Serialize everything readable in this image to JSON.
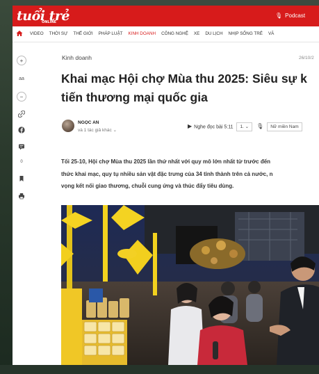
{
  "site": {
    "logo": "tuổi trẻ",
    "logo_sub": "ONLINE",
    "podcast_label": "Podcast"
  },
  "nav": {
    "items": [
      {
        "label": "VIDEO"
      },
      {
        "label": "THỜI SỰ"
      },
      {
        "label": "THẾ GIỚI"
      },
      {
        "label": "PHÁP LUẬT"
      },
      {
        "label": "KINH DOANH",
        "active": true
      },
      {
        "label": "CÔNG NGHỆ"
      },
      {
        "label": "XE"
      },
      {
        "label": "DU LỊCH"
      },
      {
        "label": "NHỊP SỐNG TRẺ"
      },
      {
        "label": "VĂ"
      }
    ]
  },
  "toolbar": {
    "font_size_label": "aa",
    "comment_count": "0"
  },
  "article": {
    "category": "Kinh doanh",
    "date": "26/10/2",
    "title_line1": "Khai mạc Hội chợ Mùa thu 2025: Siêu sự k",
    "title_line2": "tiến thương mại quốc gia",
    "author_name": "NGỌC AN",
    "author_more": "và 1 tác giả khác",
    "listen_label": "Nghe đọc bài",
    "duration": "5:11",
    "speed": "1.",
    "voice": "Nữ miền Nam",
    "intro_lines": [
      "Tối 25-10, Hội chợ Mùa thu 2025 lần thứ nhất với quy mô lớn nhất từ trước đến",
      "thức khai mạc, quy tụ nhiều sản vật đặc trưng của 34 tỉnh thành trên cả nước, n",
      "vọng kết nối giao thương, chuỗi cung ứng và thúc đẩy tiêu dùng."
    ]
  }
}
